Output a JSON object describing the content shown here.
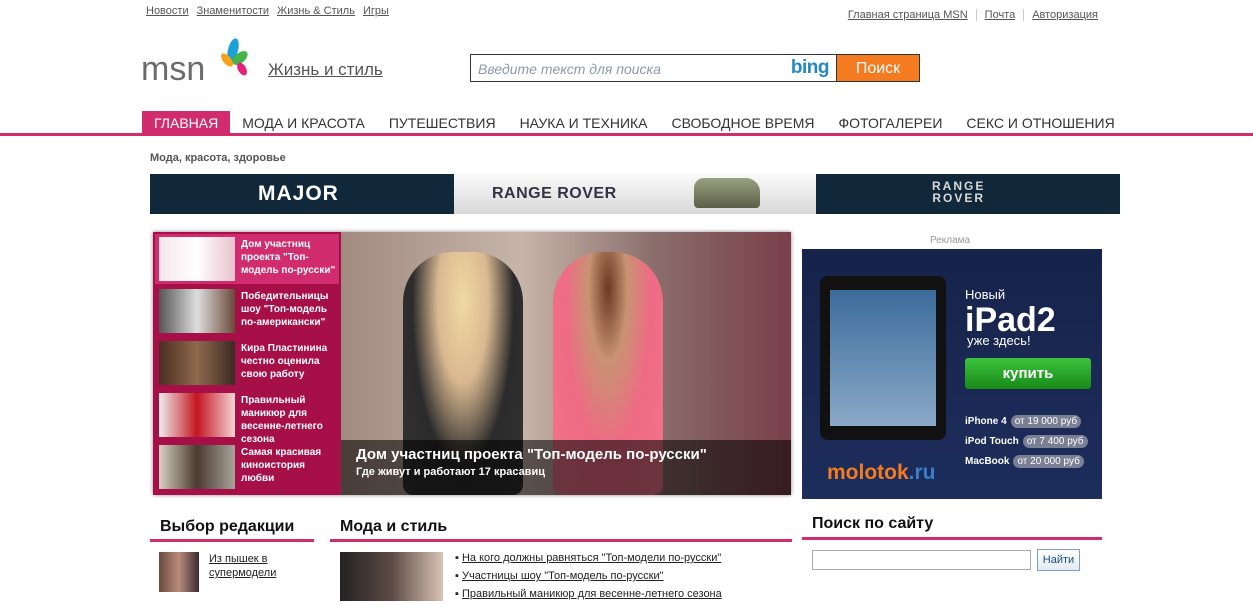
{
  "top_links": [
    "Новости",
    "Знаменитости",
    "Жизнь & Стиль",
    "Игры"
  ],
  "right_links": [
    "Главная страница MSN",
    "Почта",
    "Авторизация"
  ],
  "logo_text": "msn",
  "section_title": "Жизнь и стиль",
  "search": {
    "placeholder": "Введите текст для поиска",
    "bing": "bing",
    "button": "Поиск"
  },
  "nav": [
    "ГЛАВНАЯ",
    "МОДА И КРАСОТА",
    "ПУТЕШЕСТВИЯ",
    "НАУКА И ТЕХНИКА",
    "СВОБОДНОЕ ВРЕМЯ",
    "ФОТОГАЛЕРЕИ",
    "СЕКС И ОТНОШЕНИЯ"
  ],
  "breadcrumb": "Мода, красота, здоровье",
  "banner": {
    "left": "MAJOR",
    "middle": "RANGE ROVER",
    "right_line1": "RANGE",
    "right_line2": "ROVER"
  },
  "slider": {
    "thumbs": [
      "Дом участниц проекта \"Топ-модель по-русски\"",
      "Победительницы шоу \"Топ-модель по-американски\"",
      "Кира Пластинина честно оценила свою работу",
      "Правильный маникюр для весенне-летнего сезона",
      "Самая красивая киноистория любви"
    ],
    "caption_title": "Дом участниц проекта \"Топ-модель по-русски\"",
    "caption_sub": "Где живут и работают 17 красавиц"
  },
  "ad": {
    "label": "Реклама",
    "new": "Новый",
    "product": "iPad2",
    "here": "уже здесь!",
    "buy": "купить",
    "prices": [
      {
        "name": "iPhone 4",
        "price": "от 19 000 руб"
      },
      {
        "name": "iPod Touch",
        "price": "от 7 400 руб"
      },
      {
        "name": "MacBook",
        "price": "от 20 000 руб"
      }
    ],
    "brand": "molotok",
    "brand_tld": ".ru"
  },
  "editors": {
    "title": "Выбор редакции",
    "link": "Из пышек в супермодели"
  },
  "fashion": {
    "title": "Мода и стиль",
    "links": [
      "На кого должны равняться \"Топ-модели по-русски\"",
      "Участницы шоу \"Топ-модель по-русски\"",
      "Правильный маникюр для весенне-летнего сезона"
    ]
  },
  "site_search": {
    "title": "Поиск по сайту",
    "button": "Найти"
  }
}
